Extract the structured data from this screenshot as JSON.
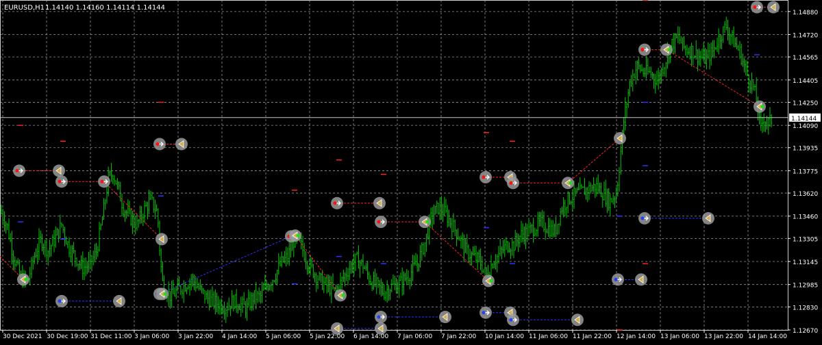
{
  "header": {
    "symbol": "EURUSD,H1",
    "ohlc": "1.14140 1.14160 1.14114 1.14144"
  },
  "price_axis": {
    "labels": [
      "1.14880",
      "1.14720",
      "1.14565",
      "1.14405",
      "1.14250",
      "1.14090",
      "1.13935",
      "1.13775",
      "1.13620",
      "1.13460",
      "1.13305",
      "1.13145",
      "1.12985",
      "1.12830",
      "1.12670"
    ],
    "current_price": "1.14144"
  },
  "time_axis": {
    "labels": [
      "30 Dec 2021",
      "30 Dec 19:00",
      "31 Dec 11:00",
      "3 Jan 06:00",
      "3 Jan 22:00",
      "4 Jan 14:00",
      "5 Jan 06:00",
      "5 Jan 22:00",
      "6 Jan 14:00",
      "7 Jan 06:00",
      "7 Jan 22:00",
      "10 Jan 14:00",
      "11 Jan 06:00",
      "11 Jan 22:00",
      "12 Jan 14:00",
      "13 Jan 06:00",
      "13 Jan 22:00",
      "14 Jan 14:00"
    ]
  },
  "colors": {
    "background": "#000000",
    "candles": "#00cc00",
    "grid": "#c8c8c8",
    "axis_text": "#ffffff",
    "sell_line": "#ff2020",
    "buy_line": "#3030ff",
    "marker": "#9a9a9a",
    "marker_arrow": "#d4b04a",
    "current_price_box": "#ffffff"
  },
  "chart_data": {
    "type": "candlestick",
    "symbol": "EURUSD",
    "timeframe": "H1",
    "ylim": [
      1.1267,
      1.1496
    ],
    "last_close": 1.14144,
    "close_path": [
      [
        0,
        1.135
      ],
      [
        10,
        1.134
      ],
      [
        20,
        1.1318
      ],
      [
        30,
        1.1303
      ],
      [
        40,
        1.13
      ],
      [
        50,
        1.1318
      ],
      [
        60,
        1.133
      ],
      [
        70,
        1.1322
      ],
      [
        80,
        1.133
      ],
      [
        90,
        1.134
      ],
      [
        100,
        1.1325
      ],
      [
        110,
        1.1318
      ],
      [
        120,
        1.131
      ],
      [
        130,
        1.1312
      ],
      [
        140,
        1.132
      ],
      [
        150,
        1.1345
      ],
      [
        158,
        1.1372
      ],
      [
        165,
        1.1376
      ],
      [
        172,
        1.1366
      ],
      [
        180,
        1.1352
      ],
      [
        190,
        1.1345
      ],
      [
        200,
        1.134
      ],
      [
        210,
        1.135
      ],
      [
        220,
        1.1357
      ],
      [
        230,
        1.1348
      ],
      [
        234,
        1.1316
      ],
      [
        238,
        1.1297
      ],
      [
        250,
        1.129
      ],
      [
        260,
        1.1295
      ],
      [
        270,
        1.1298
      ],
      [
        280,
        1.1303
      ],
      [
        290,
        1.1296
      ],
      [
        300,
        1.129
      ],
      [
        310,
        1.1287
      ],
      [
        320,
        1.1285
      ],
      [
        330,
        1.1283
      ],
      [
        340,
        1.1287
      ],
      [
        350,
        1.1285
      ],
      [
        360,
        1.1282
      ],
      [
        370,
        1.129
      ],
      [
        380,
        1.129
      ],
      [
        390,
        1.1298
      ],
      [
        400,
        1.1304
      ],
      [
        410,
        1.1313
      ],
      [
        420,
        1.1318
      ],
      [
        430,
        1.133
      ],
      [
        440,
        1.1325
      ],
      [
        450,
        1.1313
      ],
      [
        460,
        1.1306
      ],
      [
        470,
        1.13
      ],
      [
        480,
        1.1297
      ],
      [
        490,
        1.1293
      ],
      [
        500,
        1.1302
      ],
      [
        510,
        1.131
      ],
      [
        520,
        1.1316
      ],
      [
        530,
        1.1312
      ],
      [
        540,
        1.1302
      ],
      [
        550,
        1.1298
      ],
      [
        560,
        1.1293
      ],
      [
        570,
        1.1297
      ],
      [
        580,
        1.1298
      ],
      [
        590,
        1.1302
      ],
      [
        600,
        1.1307
      ],
      [
        610,
        1.1314
      ],
      [
        620,
        1.1327
      ],
      [
        630,
        1.1346
      ],
      [
        640,
        1.1352
      ],
      [
        650,
        1.1348
      ],
      [
        660,
        1.134
      ],
      [
        670,
        1.1332
      ],
      [
        680,
        1.1322
      ],
      [
        690,
        1.1318
      ],
      [
        700,
        1.1315
      ],
      [
        710,
        1.1305
      ],
      [
        720,
        1.1315
      ],
      [
        730,
        1.132
      ],
      [
        740,
        1.1326
      ],
      [
        750,
        1.1326
      ],
      [
        760,
        1.1333
      ],
      [
        770,
        1.1335
      ],
      [
        780,
        1.1338
      ],
      [
        790,
        1.1341
      ],
      [
        800,
        1.1338
      ],
      [
        810,
        1.1335
      ],
      [
        820,
        1.1352
      ],
      [
        830,
        1.1358
      ],
      [
        840,
        1.1361
      ],
      [
        850,
        1.1363
      ],
      [
        860,
        1.1365
      ],
      [
        870,
        1.1367
      ],
      [
        880,
        1.1362
      ],
      [
        890,
        1.1356
      ],
      [
        900,
        1.1362
      ],
      [
        905,
        1.1385
      ],
      [
        910,
        1.141
      ],
      [
        920,
        1.144
      ],
      [
        930,
        1.145
      ],
      [
        940,
        1.1446
      ],
      [
        950,
        1.1445
      ],
      [
        960,
        1.144
      ],
      [
        970,
        1.1452
      ],
      [
        980,
        1.1465
      ],
      [
        990,
        1.147
      ],
      [
        1000,
        1.1462
      ],
      [
        1010,
        1.1461
      ],
      [
        1020,
        1.1457
      ],
      [
        1030,
        1.1455
      ],
      [
        1040,
        1.146
      ],
      [
        1050,
        1.147
      ],
      [
        1060,
        1.1478
      ],
      [
        1070,
        1.1468
      ],
      [
        1080,
        1.146
      ],
      [
        1090,
        1.1445
      ],
      [
        1100,
        1.1435
      ],
      [
        1105,
        1.1425
      ],
      [
        1110,
        1.1405
      ],
      [
        1115,
        1.1415
      ],
      [
        1120,
        1.141
      ],
      [
        1125,
        1.1412
      ],
      [
        1128,
        1.1414
      ]
    ],
    "trade_markers": [
      {
        "x": 28,
        "price": 1.13775,
        "arrow": "right",
        "dot": "red"
      },
      {
        "x": 86,
        "price": 1.13775,
        "arrow": "left",
        "dot": "none"
      },
      {
        "x": 90,
        "price": 1.137,
        "arrow": "right",
        "dot": "red"
      },
      {
        "x": 152,
        "price": 1.137,
        "arrow": "right",
        "dot": "red"
      },
      {
        "x": 34,
        "price": 1.1302,
        "arrow": "left",
        "dot": "green"
      },
      {
        "x": 90,
        "price": 1.1287,
        "arrow": "right",
        "dot": "blue"
      },
      {
        "x": 174,
        "price": 1.1287,
        "arrow": "left",
        "dot": "none"
      },
      {
        "x": 233,
        "price": 1.1396,
        "arrow": "right",
        "dot": "red"
      },
      {
        "x": 265,
        "price": 1.1396,
        "arrow": "left",
        "dot": "none"
      },
      {
        "x": 236,
        "price": 1.133,
        "arrow": "left",
        "dot": "none"
      },
      {
        "x": 233,
        "price": 1.1292,
        "arrow": "right",
        "dot": "blue"
      },
      {
        "x": 237,
        "price": 1.1292,
        "arrow": "left",
        "dot": "green"
      },
      {
        "x": 425,
        "price": 1.1332,
        "arrow": "right",
        "dot": "red"
      },
      {
        "x": 431,
        "price": 1.13325,
        "arrow": "left",
        "dot": "green"
      },
      {
        "x": 497,
        "price": 1.1291,
        "arrow": "left",
        "dot": "green"
      },
      {
        "x": 492,
        "price": 1.1355,
        "arrow": "right",
        "dot": "red"
      },
      {
        "x": 554,
        "price": 1.1355,
        "arrow": "left",
        "dot": "none"
      },
      {
        "x": 556,
        "price": 1.1342,
        "arrow": "right",
        "dot": "red"
      },
      {
        "x": 620,
        "price": 1.1342,
        "arrow": "left",
        "dot": "green"
      },
      {
        "x": 492,
        "price": 1.1268,
        "arrow": "left",
        "dot": "none"
      },
      {
        "x": 556,
        "price": 1.1276,
        "arrow": "right",
        "dot": "blue"
      },
      {
        "x": 650,
        "price": 1.1276,
        "arrow": "left",
        "dot": "none"
      },
      {
        "x": 556,
        "price": 1.1268,
        "arrow": "left",
        "dot": "none"
      },
      {
        "x": 709,
        "price": 1.1373,
        "arrow": "right",
        "dot": "red"
      },
      {
        "x": 745,
        "price": 1.1373,
        "arrow": "left",
        "dot": "none"
      },
      {
        "x": 749,
        "price": 1.1369,
        "arrow": "right",
        "dot": "red"
      },
      {
        "x": 829,
        "price": 1.1369,
        "arrow": "left",
        "dot": "green"
      },
      {
        "x": 713,
        "price": 1.1301,
        "arrow": "left",
        "dot": "green"
      },
      {
        "x": 709,
        "price": 1.1279,
        "arrow": "right",
        "dot": "blue"
      },
      {
        "x": 745,
        "price": 1.1279,
        "arrow": "left",
        "dot": "none"
      },
      {
        "x": 749,
        "price": 1.1274,
        "arrow": "right",
        "dot": "blue"
      },
      {
        "x": 843,
        "price": 1.1274,
        "arrow": "left",
        "dot": "none"
      },
      {
        "x": 905,
        "price": 1.14,
        "arrow": "left",
        "dot": "none"
      },
      {
        "x": 941,
        "price": 1.14615,
        "arrow": "right",
        "dot": "red"
      },
      {
        "x": 973,
        "price": 1.14615,
        "arrow": "left",
        "dot": "green"
      },
      {
        "x": 941,
        "price": 1.13445,
        "arrow": "right",
        "dot": "blue"
      },
      {
        "x": 1034,
        "price": 1.13445,
        "arrow": "left",
        "dot": "none"
      },
      {
        "x": 902,
        "price": 1.1302,
        "arrow": "right",
        "dot": "blue"
      },
      {
        "x": 936,
        "price": 1.1302,
        "arrow": "left",
        "dot": "none"
      },
      {
        "x": 1109,
        "price": 1.1422,
        "arrow": "left",
        "dot": "green"
      },
      {
        "x": 1105,
        "price": 1.1491,
        "arrow": "right",
        "dot": "red"
      },
      {
        "x": 1129,
        "price": 1.1491,
        "arrow": "left",
        "dot": "none"
      }
    ],
    "trade_lines": [
      {
        "x1": 28,
        "p1": 1.13775,
        "x2": 86,
        "p2": 1.13775,
        "side": "sell"
      },
      {
        "x1": 90,
        "p1": 1.137,
        "x2": 152,
        "p2": 1.137,
        "side": "sell"
      },
      {
        "x1": 0,
        "p1": 1.1318,
        "x2": 34,
        "p2": 1.1302,
        "side": "sell"
      },
      {
        "x1": 90,
        "p1": 1.1287,
        "x2": 174,
        "p2": 1.1287,
        "side": "buy"
      },
      {
        "x1": 233,
        "p1": 1.1396,
        "x2": 265,
        "p2": 1.1396,
        "side": "sell"
      },
      {
        "x1": 152,
        "p1": 1.137,
        "x2": 236,
        "p2": 1.133,
        "side": "sell"
      },
      {
        "x1": 233,
        "p1": 1.1292,
        "x2": 425,
        "p2": 1.1332,
        "side": "buy"
      },
      {
        "x1": 431,
        "p1": 1.13325,
        "x2": 497,
        "p2": 1.1291,
        "side": "sell"
      },
      {
        "x1": 492,
        "p1": 1.1355,
        "x2": 554,
        "p2": 1.1355,
        "side": "sell"
      },
      {
        "x1": 556,
        "p1": 1.1342,
        "x2": 620,
        "p2": 1.1342,
        "side": "sell"
      },
      {
        "x1": 620,
        "p1": 1.1342,
        "x2": 713,
        "p2": 1.1301,
        "side": "sell"
      },
      {
        "x1": 492,
        "p1": 1.1268,
        "x2": 556,
        "p2": 1.1268,
        "side": "buy"
      },
      {
        "x1": 556,
        "p1": 1.1276,
        "x2": 650,
        "p2": 1.1276,
        "side": "buy"
      },
      {
        "x1": 709,
        "p1": 1.1373,
        "x2": 745,
        "p2": 1.1373,
        "side": "sell"
      },
      {
        "x1": 749,
        "p1": 1.1369,
        "x2": 829,
        "p2": 1.1369,
        "side": "sell"
      },
      {
        "x1": 829,
        "p1": 1.1369,
        "x2": 905,
        "p2": 1.14,
        "side": "sell"
      },
      {
        "x1": 709,
        "p1": 1.1279,
        "x2": 745,
        "p2": 1.1279,
        "side": "buy"
      },
      {
        "x1": 749,
        "p1": 1.1274,
        "x2": 843,
        "p2": 1.1274,
        "side": "buy"
      },
      {
        "x1": 941,
        "p1": 1.14615,
        "x2": 973,
        "p2": 1.14615,
        "side": "sell"
      },
      {
        "x1": 973,
        "p1": 1.14615,
        "x2": 1109,
        "p2": 1.1422,
        "side": "sell"
      },
      {
        "x1": 941,
        "p1": 1.13445,
        "x2": 1034,
        "p2": 1.13445,
        "side": "buy"
      },
      {
        "x1": 902,
        "p1": 1.1302,
        "x2": 936,
        "p2": 1.1302,
        "side": "buy"
      },
      {
        "x1": 1105,
        "p1": 1.1491,
        "x2": 1129,
        "p2": 1.1491,
        "side": "sell"
      }
    ],
    "order_dashes": [
      {
        "x": 30,
        "price": 1.1409,
        "side": "sell"
      },
      {
        "x": 92,
        "price": 1.1398,
        "side": "sell"
      },
      {
        "x": 30,
        "price": 1.1342,
        "side": "buy"
      },
      {
        "x": 92,
        "price": 1.133,
        "side": "buy"
      },
      {
        "x": 235,
        "price": 1.1425,
        "side": "sell"
      },
      {
        "x": 235,
        "price": 1.136,
        "side": "buy"
      },
      {
        "x": 430,
        "price": 1.1364,
        "side": "sell"
      },
      {
        "x": 430,
        "price": 1.1299,
        "side": "buy"
      },
      {
        "x": 495,
        "price": 1.1385,
        "side": "sell"
      },
      {
        "x": 495,
        "price": 1.1318,
        "side": "buy"
      },
      {
        "x": 560,
        "price": 1.1375,
        "side": "sell"
      },
      {
        "x": 560,
        "price": 1.1313,
        "side": "buy"
      },
      {
        "x": 710,
        "price": 1.1404,
        "side": "sell"
      },
      {
        "x": 710,
        "price": 1.1338,
        "side": "buy"
      },
      {
        "x": 748,
        "price": 1.1398,
        "side": "sell"
      },
      {
        "x": 748,
        "price": 1.1313,
        "side": "buy"
      },
      {
        "x": 942,
        "price": 1.1313,
        "side": "sell"
      },
      {
        "x": 942,
        "price": 1.1425,
        "side": "buy"
      },
      {
        "x": 942,
        "price": 1.1381,
        "side": "buy"
      },
      {
        "x": 905,
        "price": 1.1346,
        "side": "buy"
      },
      {
        "x": 905,
        "price": 1.1267,
        "side": "sell"
      },
      {
        "x": 1105,
        "price": 1.1458,
        "side": "buy"
      },
      {
        "x": 942,
        "price": 1.1496,
        "side": "sell"
      }
    ]
  }
}
